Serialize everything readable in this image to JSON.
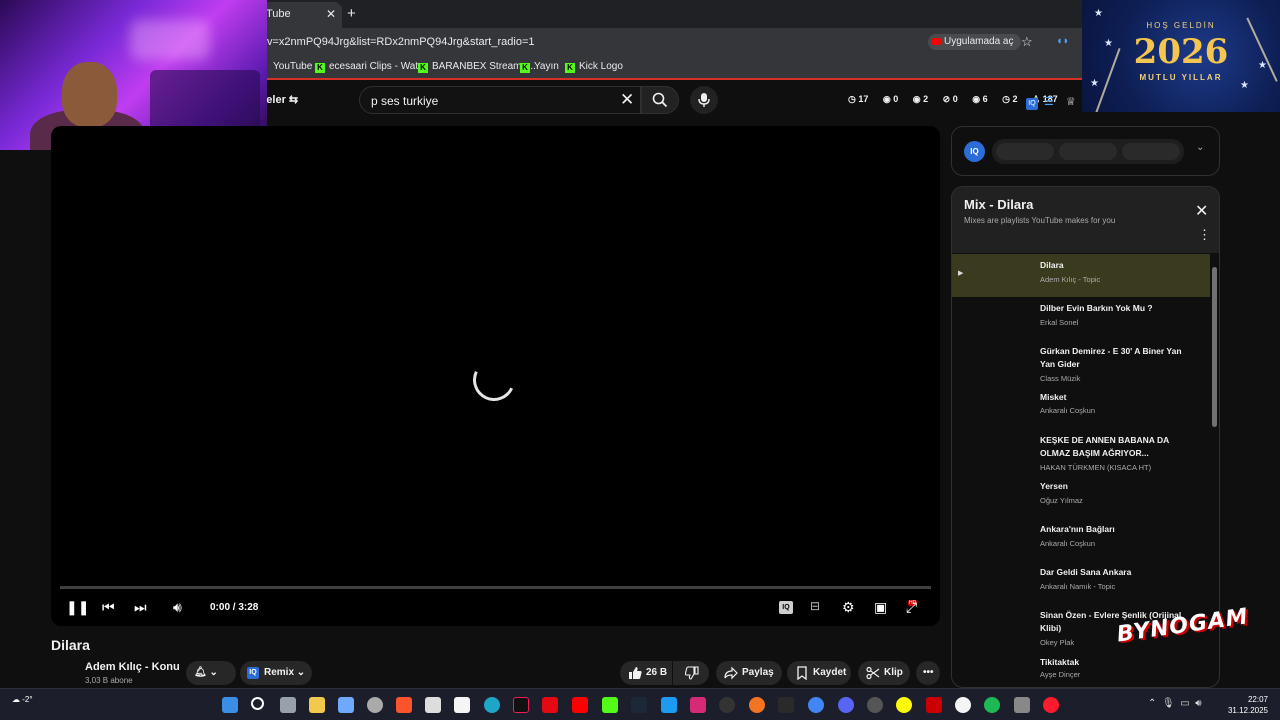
{
  "browser": {
    "tab_title": "Tube",
    "url": "v=x2nmPQ94Jrg&list=RDx2nmPQ94Jrg&start_radio=1",
    "open_in_app": "Uygulamada aç",
    "bookmarks": [
      "YouTube",
      "ecesaari Clips - Wat...",
      "BARANBEX Stream -...",
      "Yayın",
      "Kick Logo"
    ]
  },
  "yt_header": {
    "filter_label": "reler",
    "search_value": "p ses turkiye",
    "stats": [
      "17",
      "0",
      "2",
      "0",
      "6",
      "2",
      "187"
    ]
  },
  "banner": {
    "greeting": "HOŞ GELDİN",
    "year": "2026",
    "wish": "MUTLU YILLAR"
  },
  "player": {
    "time": "0:00 / 3:28",
    "iq_label": "IQ",
    "hd_badge": "HD"
  },
  "video": {
    "title": "Dilara",
    "channel": "Adem Kılıç - Konu",
    "subscribers": "3,03 B abone",
    "remix_label": "Remix",
    "likes": "26 B",
    "share_label": "Paylaş",
    "save_label": "Kaydet",
    "clip_label": "Klip"
  },
  "iq_panel": {
    "logo": "IQ"
  },
  "playlist": {
    "title": "Mix - Dilara",
    "subtitle": "Mixes are playlists YouTube makes for you",
    "items": [
      {
        "title": "Dilara",
        "artist": "Adem Kılıç - Topic"
      },
      {
        "title": "Dilber Evin Barkın Yok Mu ?",
        "artist": "Erkal Sonel"
      },
      {
        "title": "Gürkan Demirez - E 30' A Biner Yan Yan Gider",
        "artist": "Class Müzik"
      },
      {
        "title": "Misket",
        "artist": "Ankaralı Coşkun"
      },
      {
        "title": "KEŞKE DE ANNEN BABANA DA OLMAZ BAŞIM AĞRIYOR...",
        "artist": "HAKAN TÜRKMEN (KISACA HT)"
      },
      {
        "title": "Yersen",
        "artist": "Oğuz Yılmaz"
      },
      {
        "title": "Ankara'nın Bağları",
        "artist": "Ankaralı Coşkun"
      },
      {
        "title": "Dar Geldi Sana Ankara",
        "artist": "Ankaralı Namık - Topic"
      },
      {
        "title": "Sinan Özen - Evlere Şenlik (Orijinal Klibi)",
        "artist": "Okey Plak"
      },
      {
        "title": "Tikitaktak",
        "artist": "Ayşe Dinçer"
      }
    ]
  },
  "watermark": "BYNOGAM",
  "taskbar": {
    "weather": "-2°",
    "time": "22:07",
    "date": "31.12.2025"
  },
  "colors": {
    "accent_red": "#ff0000",
    "kick_green": "#53fc18",
    "iq_blue": "#2b6cd6",
    "active_row": "#3a3a1e"
  }
}
